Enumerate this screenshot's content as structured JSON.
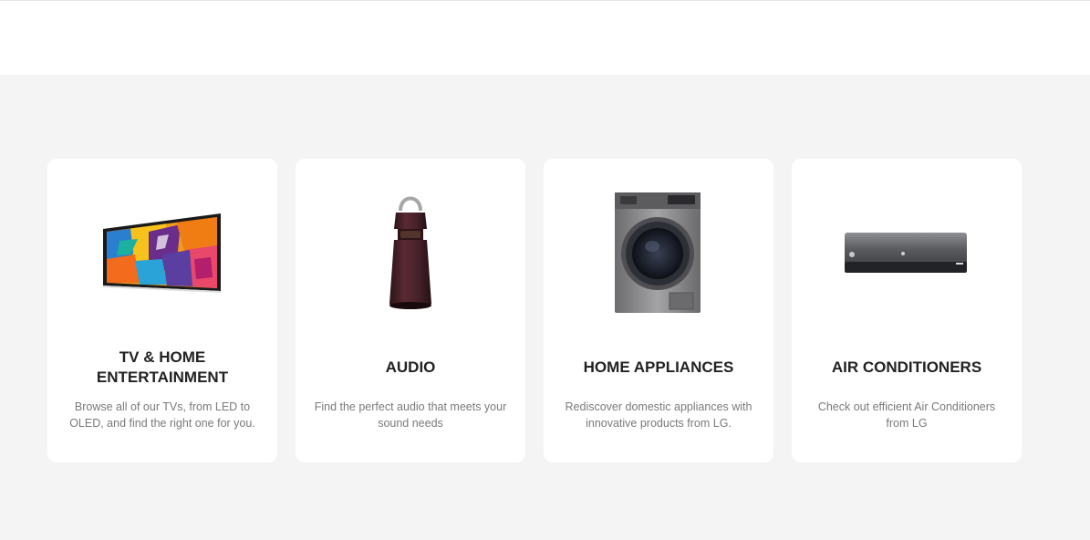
{
  "categories": [
    {
      "title": "TV & HOME ENTERTAINMENT",
      "title_line1": "TV & HOME",
      "title_line2": "ENTERTAINMENT",
      "description": "Browse all of our TVs, from LED to OLED, and find the right one for you."
    },
    {
      "title": "AUDIO",
      "description": "Find the perfect audio that meets your sound needs"
    },
    {
      "title": "HOME APPLIANCES",
      "description": "Rediscover domestic appliances with innovative products from LG."
    },
    {
      "title": "AIR CONDITIONERS",
      "description": "Check out efficient Air Conditioners from LG"
    }
  ],
  "colors": {
    "page_background": "#f4f4f4",
    "card_background": "#ffffff",
    "title_text": "#222222",
    "description_text": "#7a7a7a"
  }
}
